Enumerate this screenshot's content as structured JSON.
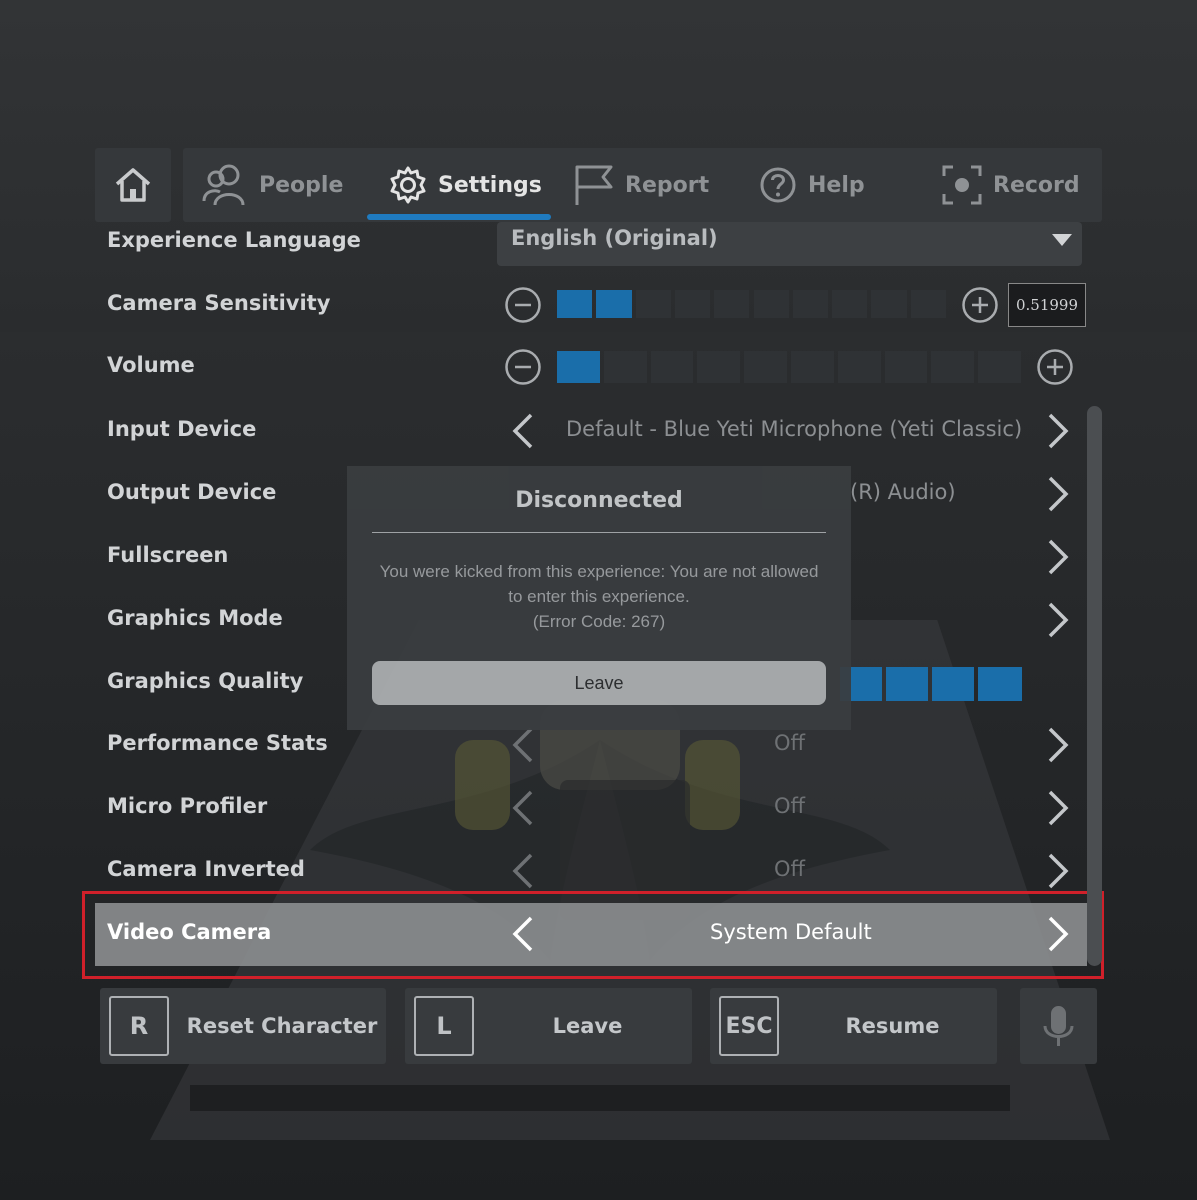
{
  "tabs": [
    {
      "label": "People",
      "icon": "people-icon"
    },
    {
      "label": "Settings",
      "icon": "gear-icon",
      "active": true
    },
    {
      "label": "Report",
      "icon": "flag-icon"
    },
    {
      "label": "Help",
      "icon": "help-icon"
    },
    {
      "label": "Record",
      "icon": "record-icon"
    }
  ],
  "settings": {
    "experience_language": {
      "label": "Experience Language",
      "value": "English (Original)"
    },
    "camera_sensitivity": {
      "label": "Camera Sensitivity",
      "value": "0.51999",
      "level_segments_on": 2,
      "segments_total": 10
    },
    "volume": {
      "label": "Volume",
      "level_segments_on": 1,
      "segments_total": 10
    },
    "input_device": {
      "label": "Input Device",
      "value": "Default - Blue Yeti Microphone (Yeti Classic)"
    },
    "output_device": {
      "label": "Output Device",
      "value": "(R) Audio)"
    },
    "fullscreen": {
      "label": "Fullscreen"
    },
    "graphics_mode": {
      "label": "Graphics Mode"
    },
    "graphics_quality": {
      "label": "Graphics Quality"
    },
    "performance_stats": {
      "label": "Performance Stats",
      "value": "Off"
    },
    "micro_profiler": {
      "label": "Micro Profiler",
      "value": "Off"
    },
    "camera_inverted": {
      "label": "Camera Inverted",
      "value": "Off"
    },
    "video_camera": {
      "label": "Video Camera",
      "value": "System Default"
    }
  },
  "modal": {
    "title": "Disconnected",
    "message": "You were kicked from this experience: You are not allowed to enter this experience.",
    "error_code": "(Error Code: 267)",
    "button": "Leave"
  },
  "bottom": {
    "reset": {
      "key": "R",
      "label": "Reset Character"
    },
    "leave": {
      "key": "L",
      "label": "Leave"
    },
    "resume": {
      "key": "ESC",
      "label": "Resume"
    },
    "mic_icon": "microphone-icon"
  },
  "colors": {
    "accent": "#1f7bc0",
    "focus": "#d0202a"
  }
}
